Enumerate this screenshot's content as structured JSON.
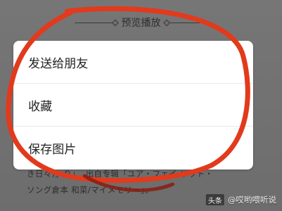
{
  "section": {
    "title": "预览播放"
  },
  "menu": {
    "items": [
      {
        "label": "发送给朋友"
      },
      {
        "label": "收藏"
      },
      {
        "label": "保存图片"
      }
    ]
  },
  "article": {
    "line1": "き日々)」り」, 出自专辑「ユア・フェイ リット・",
    "line2": "ソング倉本 和菜/マイメモリー」。"
  },
  "watermark": {
    "logo": "头条",
    "text": "@哎哟喂听说"
  },
  "annotation_color": "#e23a1c"
}
